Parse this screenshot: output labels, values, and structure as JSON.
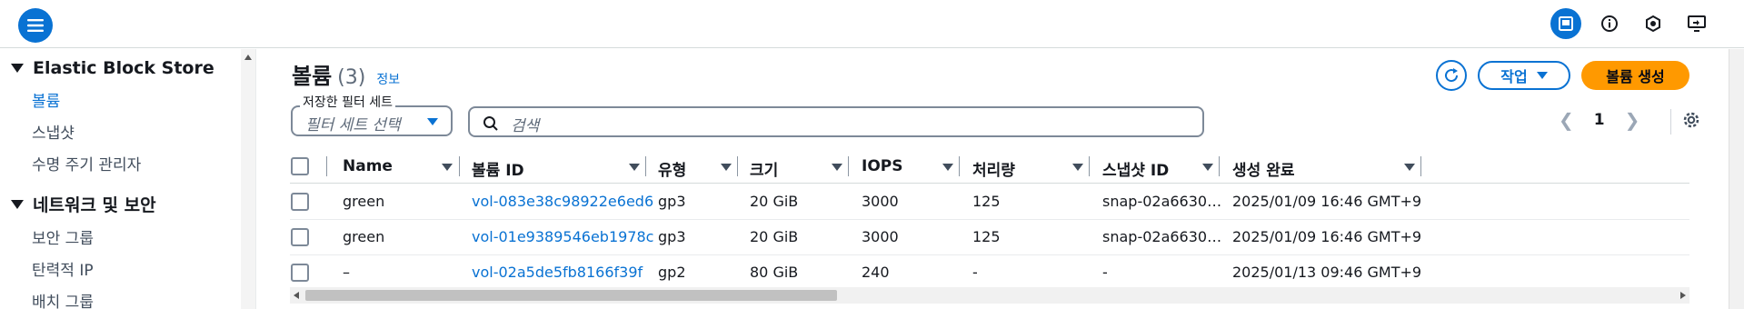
{
  "topbar": {
    "icons": [
      "menu-icon",
      "panel-icon",
      "info-icon",
      "settings-hex-icon",
      "screen-share-icon"
    ],
    "accent": "#0972d3"
  },
  "sidebar": {
    "sections": [
      {
        "label": "Elastic Block Store",
        "items": [
          {
            "label": "볼륨",
            "active": true
          },
          {
            "label": "스냅샷",
            "active": false
          },
          {
            "label": "수명 주기 관리자",
            "active": false
          }
        ]
      },
      {
        "label": "네트워크 및 보안",
        "items": [
          {
            "label": "보안 그룹",
            "active": false
          },
          {
            "label": "탄력적 IP",
            "active": false
          },
          {
            "label": "배치 그룹",
            "active": false
          }
        ]
      }
    ]
  },
  "header": {
    "title": "볼륨",
    "count": "(3)",
    "info": "정보",
    "action_label": "작업",
    "create_label": "볼륨 생성"
  },
  "filters": {
    "saved_label": "저장한 필터 세트",
    "saved_placeholder": "필터 세트 선택",
    "search_placeholder": "검색"
  },
  "pagination": {
    "current_page": "1"
  },
  "table": {
    "columns": [
      "Name",
      "볼륨 ID",
      "유형",
      "크기",
      "IOPS",
      "처리량",
      "스냅샷 ID",
      "생성 완료"
    ],
    "rows": [
      {
        "name": "green",
        "volume_id": "vol-083e38c98922e6ed6",
        "type": "gp3",
        "size": "20 GiB",
        "iops": "3000",
        "throughput": "125",
        "snapshot": "snap-02a6630…",
        "created": "2025/01/09 16:46 GMT+9"
      },
      {
        "name": "green",
        "volume_id": "vol-01e9389546eb1978c",
        "type": "gp3",
        "size": "20 GiB",
        "iops": "3000",
        "throughput": "125",
        "snapshot": "snap-02a6630…",
        "created": "2025/01/09 16:46 GMT+9"
      },
      {
        "name": "–",
        "volume_id": "vol-02a5de5fb8166f39f",
        "type": "gp2",
        "size": "80 GiB",
        "iops": "240",
        "throughput": "-",
        "snapshot": "-",
        "created": "2025/01/13 09:46 GMT+9"
      }
    ]
  },
  "colors": {
    "link": "#0972d3",
    "primary_button": "#ff9900"
  }
}
